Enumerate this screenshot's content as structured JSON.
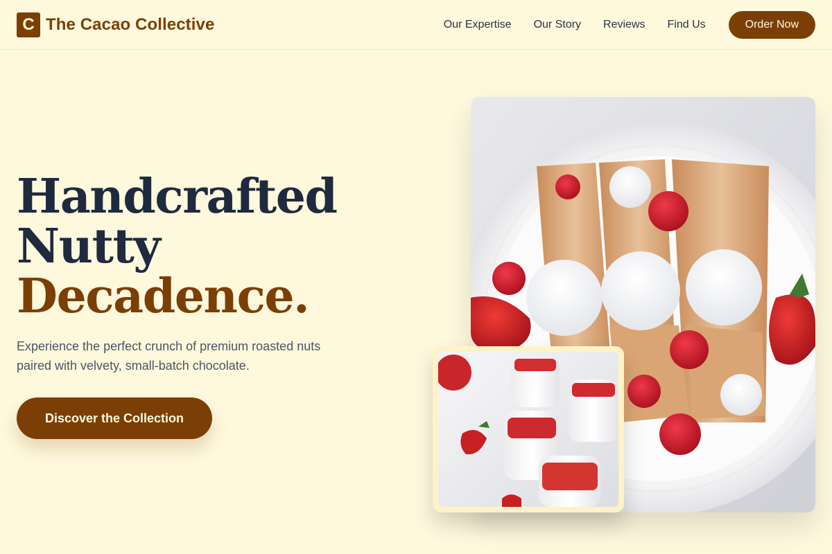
{
  "header": {
    "logo_letter": "C",
    "brand": "The Cacao Collective",
    "nav": [
      "Our Expertise",
      "Our Story",
      "Reviews",
      "Find Us"
    ],
    "order_label": "Order Now"
  },
  "hero": {
    "title_line1": "Handcrafted",
    "title_line2": "Nutty",
    "title_line3": "Decadence.",
    "subtitle": "Experience the perfect crunch of premium roasted nuts paired with velvety, small-batch chocolate.",
    "cta_label": "Discover the Collection"
  },
  "colors": {
    "background": "#fef8dd",
    "brand": "#7b3f05",
    "heading": "#1f2a3e"
  },
  "images": {
    "main": "crepes-with-cream-and-berries-photo",
    "inset": "strawberry-panna-cotta-jars-photo"
  }
}
